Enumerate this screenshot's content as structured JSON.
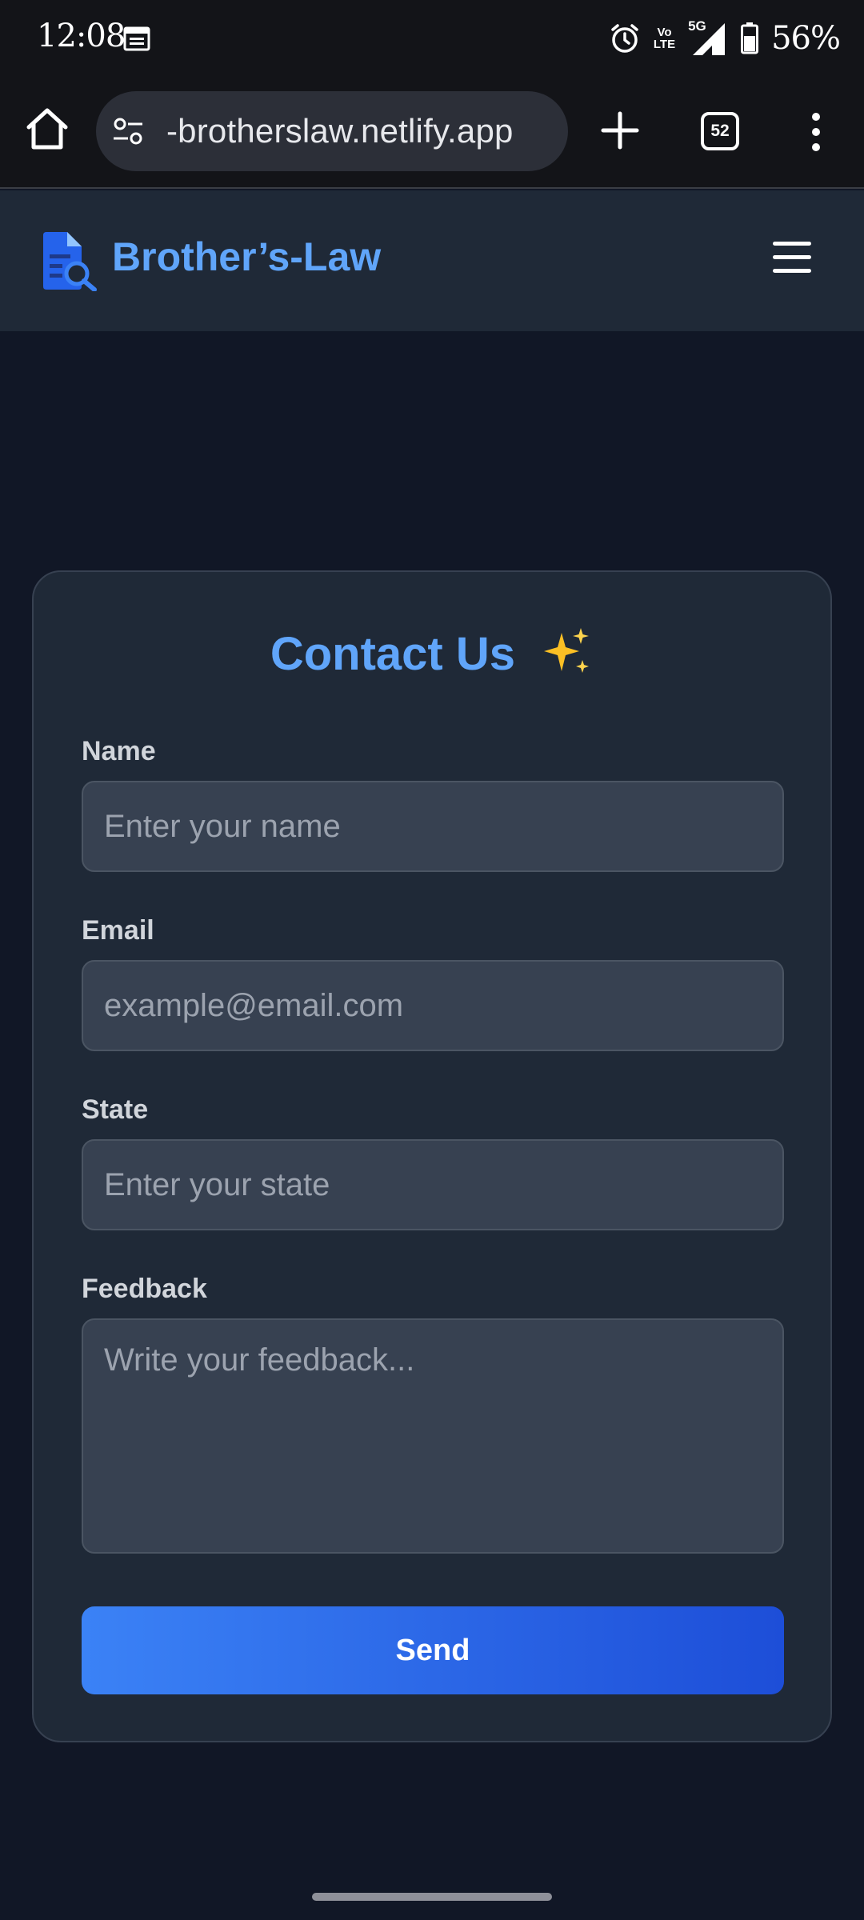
{
  "status_bar": {
    "time": "12:08",
    "network_top": "Vo",
    "network_bottom": "LTE",
    "signal_label": "5G",
    "battery": "56%"
  },
  "browser": {
    "url": "-brotherslaw.netlify.app",
    "tab_count": "52"
  },
  "header": {
    "brand": "Brother’s-Law",
    "brand_color": "#60a5fa"
  },
  "contact_form": {
    "title": "Contact Us",
    "title_emoji_icon": "sparkles-icon",
    "fields": [
      {
        "label": "Name",
        "placeholder": "Enter your name",
        "value": ""
      },
      {
        "label": "Email",
        "placeholder": "example@email.com",
        "value": ""
      },
      {
        "label": "State",
        "placeholder": "Enter your state",
        "value": ""
      },
      {
        "label": "Feedback",
        "placeholder": "Write your feedback...",
        "value": ""
      }
    ],
    "submit_label": "Send",
    "accent_gradient": [
      "#3b82f6",
      "#1d4ed8"
    ]
  },
  "icons": {
    "status": [
      "calendar-icon",
      "alarm-icon",
      "signal-icon",
      "battery-icon"
    ],
    "toolbar": [
      "home-icon",
      "site-settings-icon",
      "plus-icon",
      "tabs-icon",
      "more-vert-icon"
    ],
    "header": [
      "document-search-icon",
      "hamburger-menu-icon"
    ]
  }
}
